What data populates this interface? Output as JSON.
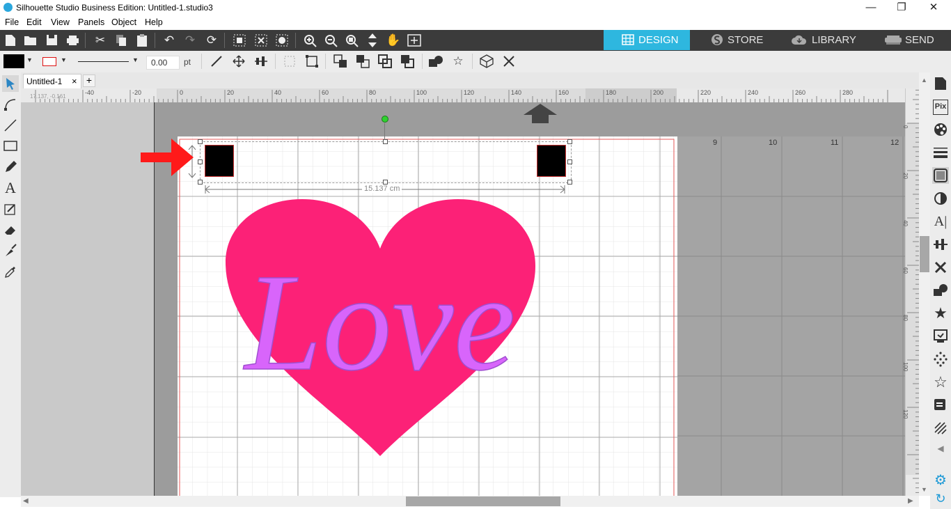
{
  "window": {
    "title": "Silhouette Studio Business Edition: Untitled-1.studio3",
    "minimize": "—",
    "restore": "❐",
    "close": "✕"
  },
  "menu": [
    "File",
    "Edit",
    "View",
    "Panels",
    "Object",
    "Help"
  ],
  "nav_tabs": [
    {
      "label": "DESIGN",
      "active": true
    },
    {
      "label": "STORE",
      "active": false
    },
    {
      "label": "LIBRARY",
      "active": false
    },
    {
      "label": "SEND",
      "active": false
    }
  ],
  "toolbar2": {
    "line_width_value": "0.00",
    "line_width_unit": "pt"
  },
  "document_tab": {
    "name": "Untitled-1",
    "close": "×",
    "add": "+"
  },
  "ruler": {
    "cursor_readout": "17.137, -0.161",
    "h_labels": [
      "-40",
      "-20",
      "0",
      "20",
      "40",
      "60",
      "80",
      "100",
      "120",
      "140",
      "160",
      "180",
      "200",
      "220",
      "240",
      "260",
      "280"
    ],
    "v_labels": [
      "0",
      "20",
      "40",
      "60",
      "80",
      "100",
      "120"
    ]
  },
  "page_numbers": [
    "9",
    "10",
    "11",
    "12"
  ],
  "selection": {
    "width_label": "15.137 cm"
  },
  "design": {
    "text": "Love",
    "heart_color": "#fc2177",
    "text_color": "#d865fb",
    "arrow_color": "#ff0000",
    "accent_color": "#2eb7df"
  }
}
